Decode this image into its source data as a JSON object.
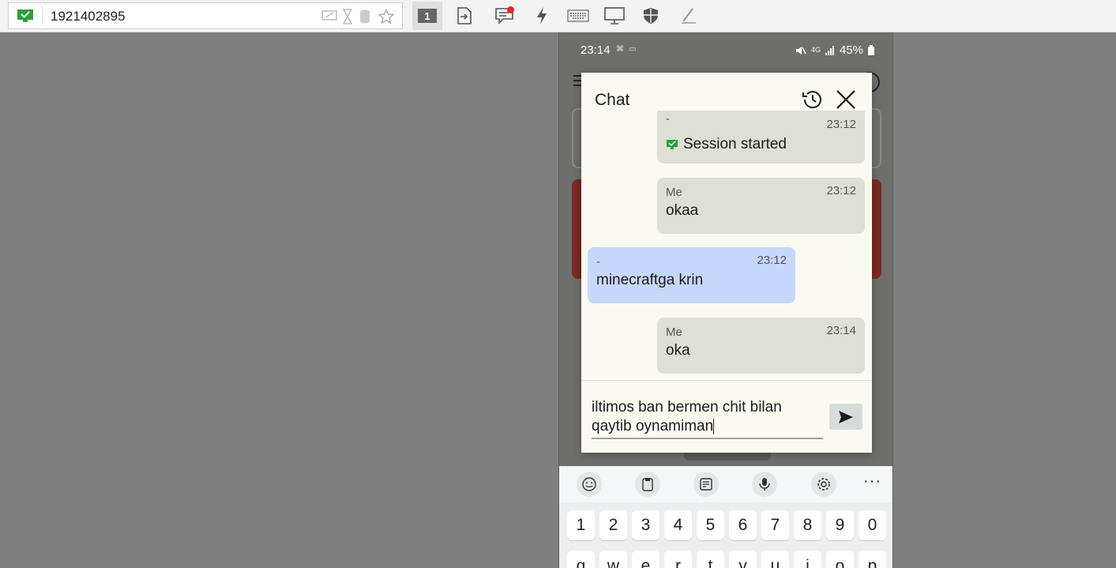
{
  "toolbar": {
    "connection_id": "1921402895",
    "monitor_number": "1",
    "icons": [
      "connection-status-icon",
      "remote-desktop-icon",
      "hourglass-icon",
      "database-icon",
      "favorite-star-icon",
      "monitor-switch-icon",
      "file-transfer-icon",
      "chat-icon",
      "actions-lightning-icon",
      "keyboard-icon",
      "display-icon",
      "privacy-shield-icon",
      "whiteboard-pen-icon"
    ],
    "accent": "#2e9e3a",
    "notification_color": "#e62b2b"
  },
  "phone": {
    "status": {
      "time": "23:14",
      "battery": "45%",
      "network": "4G"
    },
    "chat": {
      "title": "Chat",
      "messages": [
        {
          "sender": "-",
          "time": "23:12",
          "text": "Session started",
          "type": "system"
        },
        {
          "sender": "Me",
          "time": "23:12",
          "text": "okaa",
          "type": "me"
        },
        {
          "sender": "-",
          "time": "23:12",
          "text": "minecraftga krin",
          "type": "other"
        },
        {
          "sender": "Me",
          "time": "23:14",
          "text": "oka",
          "type": "me"
        }
      ],
      "input_value": "iltimos ban bermen chit bilan qaytib oynamiman",
      "colors": {
        "me_bubble": "#dedfd6",
        "other_bubble": "#c6d8fb",
        "dialog_bg": "#fbfaf1"
      }
    },
    "keyboard": {
      "tools": [
        "emoji-icon",
        "clipboard-icon",
        "text-edit-icon",
        "microphone-icon",
        "settings-icon"
      ],
      "more": "···",
      "number_row": [
        "1",
        "2",
        "3",
        "4",
        "5",
        "6",
        "7",
        "8",
        "9",
        "0"
      ],
      "letter_row": [
        "q",
        "w",
        "e",
        "r",
        "t",
        "y",
        "u",
        "i",
        "o",
        "p"
      ]
    }
  }
}
